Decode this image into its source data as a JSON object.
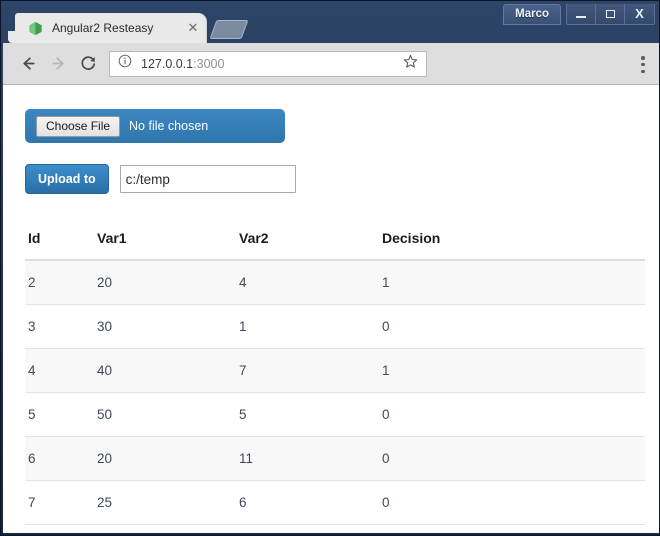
{
  "window": {
    "profile_label": "Marco",
    "minimize_label": "Minimize",
    "maximize_label": "Maximize",
    "close_label": "X",
    "frame_color": "#1b2e4b"
  },
  "tab": {
    "title": "Angular2 Resteasy",
    "close_label": "✕",
    "favicon_name": "angular-cube-icon",
    "favicon_color": "#3f9b4f"
  },
  "toolbar": {
    "back_label": "Back",
    "forward_label": "Forward",
    "reload_label": "Reload",
    "url_host": "127.0.0.1",
    "url_port": ":3000",
    "url_full": "127.0.0.1:3000",
    "bookmark_label": "Bookmark this page",
    "menu_label": "Customize and control"
  },
  "page": {
    "file_picker": {
      "button_label": "Choose File",
      "status_text": "No file chosen",
      "bar_color": "#3276b1"
    },
    "upload": {
      "button_label": "Upload to",
      "input_value": "c:/temp",
      "input_placeholder": "",
      "button_color": "#2f72ad"
    },
    "table": {
      "columns": [
        "Id",
        "Var1",
        "Var2",
        "Decision"
      ],
      "rows": [
        {
          "id": "2",
          "var1": "20",
          "var2": "4",
          "decision": "1"
        },
        {
          "id": "3",
          "var1": "30",
          "var2": "1",
          "decision": "0"
        },
        {
          "id": "4",
          "var1": "40",
          "var2": "7",
          "decision": "1"
        },
        {
          "id": "5",
          "var1": "50",
          "var2": "5",
          "decision": "0"
        },
        {
          "id": "6",
          "var1": "20",
          "var2": "11",
          "decision": "0"
        },
        {
          "id": "7",
          "var1": "25",
          "var2": "6",
          "decision": "0"
        }
      ]
    }
  }
}
